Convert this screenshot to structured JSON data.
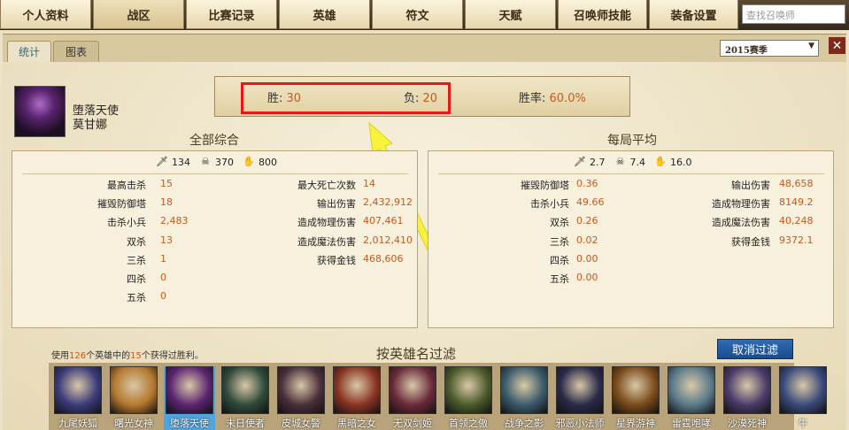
{
  "nav": {
    "tabs": [
      "个人资料",
      "战区",
      "比赛记录",
      "英雄",
      "符文",
      "天赋",
      "召唤师技能",
      "装备设置"
    ],
    "active_tab": "战区",
    "search_placeholder": "查找召唤师"
  },
  "subtabs": [
    "统计",
    "图表"
  ],
  "season": "2015赛季",
  "champion": {
    "title": "堕落天使",
    "name": "莫甘娜"
  },
  "record": {
    "win_label": "胜:",
    "win_value": "30",
    "loss_label": "负:",
    "loss_value": "20",
    "rate_label": "胜率:",
    "rate_value": "60.0%"
  },
  "totals": {
    "title": "全部综合",
    "kills": "134",
    "deaths": "370",
    "assists": "800",
    "left": [
      {
        "label": "最高击杀",
        "value": "15"
      },
      {
        "label": "摧毁防御塔",
        "value": "18"
      },
      {
        "label": "击杀小兵",
        "value": "2,483"
      },
      {
        "label": "双杀",
        "value": "13"
      },
      {
        "label": "三杀",
        "value": "1"
      },
      {
        "label": "四杀",
        "value": "0"
      },
      {
        "label": "五杀",
        "value": "0"
      }
    ],
    "right": [
      {
        "label": "最大死亡次数",
        "value": "14"
      },
      {
        "label": "输出伤害",
        "value": "2,432,912"
      },
      {
        "label": "造成物理伤害",
        "value": "407,461"
      },
      {
        "label": "造成魔法伤害",
        "value": "2,012,410"
      },
      {
        "label": "获得金钱",
        "value": "468,606"
      }
    ]
  },
  "average": {
    "title": "每局平均",
    "kills": "2.7",
    "deaths": "7.4",
    "assists": "16.0",
    "left": [
      {
        "label": "摧毁防御塔",
        "value": "0.36"
      },
      {
        "label": "击杀小兵",
        "value": "49.66"
      },
      {
        "label": "双杀",
        "value": "0.26"
      },
      {
        "label": "三杀",
        "value": "0.02"
      },
      {
        "label": "四杀",
        "value": "0.00"
      },
      {
        "label": "五杀",
        "value": "0.00"
      }
    ],
    "right": [
      {
        "label": "输出伤害",
        "value": "48,658"
      },
      {
        "label": "造成物理伤害",
        "value": "8149.2"
      },
      {
        "label": "造成魔法伤害",
        "value": "40,248"
      },
      {
        "label": "获得金钱",
        "value": "9372.1"
      }
    ]
  },
  "filter": {
    "info_a": "使用",
    "used": "126",
    "info_b": "个英雄中的",
    "won": "15",
    "info_c": "个获得过胜利。",
    "title": "按英雄名过滤",
    "cancel": "取消过滤"
  },
  "heroes": [
    {
      "name": "九尾妖狐",
      "color": "#3b3a7a"
    },
    {
      "name": "曙光女神",
      "color": "#b5782e"
    },
    {
      "name": "堕落天使",
      "color": "#5b2470",
      "selected": true
    },
    {
      "name": "末日使者",
      "color": "#2f4a3a"
    },
    {
      "name": "皮城女警",
      "color": "#4a2f3a"
    },
    {
      "name": "黑暗之女",
      "color": "#8a3322"
    },
    {
      "name": "无双剑姬",
      "color": "#6a2a3a"
    },
    {
      "name": "首领之傲",
      "color": "#4a5a2a"
    },
    {
      "name": "战争之影",
      "color": "#3a5a6a"
    },
    {
      "name": "邪恶小法师",
      "color": "#2a2a4a"
    },
    {
      "name": "星界游神",
      "color": "#7a4a1a"
    },
    {
      "name": "雷霆咆哮",
      "color": "#5a7a8a"
    },
    {
      "name": "沙漠死神",
      "color": "#4a3a6a"
    },
    {
      "name": "牛",
      "color": "#3a4a7a"
    }
  ]
}
